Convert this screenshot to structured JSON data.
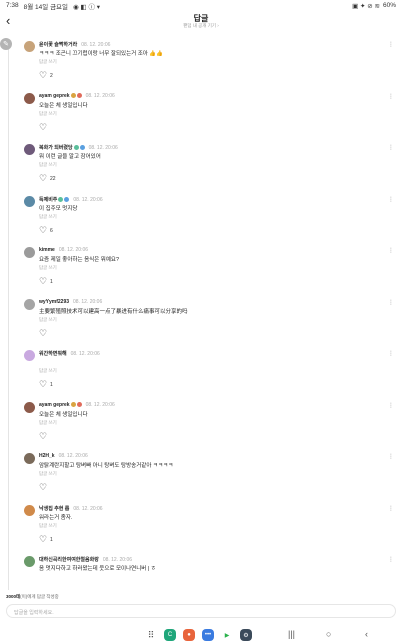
{
  "status": {
    "time": "7:38",
    "date": "8월 14일 금요일",
    "battery": "60%"
  },
  "header": {
    "back_icon": "back-arrow",
    "title": "답글",
    "subtitle": "팬덤 내 공개 기기 ›"
  },
  "comments": [
    {
      "author": "윤이꽃 슬쩍하거라",
      "time": "08. 12. 20:06",
      "text": "ㅋㅋㅋ 조곤니 끄기럽이랑 너무 잘되있는거 조아 👍👍",
      "reply": "답글 쓰기",
      "likes": "2",
      "avatar_color": "#c7a37a",
      "badges": []
    },
    {
      "author": "ayam geprek",
      "time": "08. 12. 20:06",
      "text": "오늘은 체 생일입니다",
      "reply": "답글 쓰기",
      "likes": "",
      "avatar_color": "#8c5a4a",
      "badges": [
        "#d9a441",
        "#e06b5b"
      ]
    },
    {
      "author": "복화가 되버렸당",
      "time": "08. 12. 20:06",
      "text": "뭐 이런 글을 알고 잠어있어",
      "reply": "답글 쓰기",
      "likes": "22",
      "avatar_color": "#6e5a7a",
      "badges": [
        "#5bbf9b",
        "#5aa0e0"
      ]
    },
    {
      "author": "득제비주",
      "time": "08. 12. 20:06",
      "text": "이 집주모 멋지당",
      "reply": "답글 쓰기",
      "likes": "6",
      "avatar_color": "#5b8aa6",
      "badges": [
        "#5bbf9b",
        "#5aa0e0"
      ]
    },
    {
      "author": "kimme",
      "time": "08. 12. 20:06",
      "text": "요즘 제일 좋아하는 음식은 뭐예요?",
      "reply": "답글 쓰기",
      "likes": "1",
      "avatar_color": "#9b9b9b",
      "badges": []
    },
    {
      "author": "wyYymf2293",
      "time": "08. 12. 20:06",
      "text": "主要繁殖照技术可以建高一点了暴进有什么痛事可以分享的吗",
      "reply": "답글 쓰기",
      "likes": "",
      "avatar_color": "#a5a5a5",
      "badges": []
    },
    {
      "author": "워간하면뭐해",
      "time": "08. 12. 20:06",
      "text": "",
      "reply": "답글 쓰기",
      "likes": "1",
      "avatar_color": "#c9a9e0",
      "badges": []
    },
    {
      "author": "ayam geprek",
      "time": "08. 12. 20:06",
      "text": "오늘은 체 생일입니다",
      "reply": "답글 쓰기",
      "likes": "",
      "avatar_color": "#8c5a4a",
      "badges": [
        "#d9a441",
        "#e06b5b"
      ]
    },
    {
      "author": "H2H_k",
      "time": "08. 12. 20:06",
      "text": "암탉계란지할고 탕벼빠 아니 탕벼도 탕방송거같아 ㅋㅋㅋㅋ",
      "reply": "답글 쓰기",
      "likes": "",
      "avatar_color": "#7a6a5a",
      "badges": []
    },
    {
      "author": "낙생집 추현 룹",
      "time": "08. 12. 20:06",
      "text": "워라는거 좀자.",
      "reply": "답글 쓰기",
      "likes": "1",
      "avatar_color": "#d08a4a",
      "badges": []
    },
    {
      "author": "대하신곡리한여여한철음화랑",
      "time": "08. 12. 20:06",
      "text": "음 멋지다하고 하러왔는데 웃으로 모이나연니버 | ㅎ",
      "reply": "",
      "likes": "",
      "avatar_color": "#6a9a6a",
      "badges": []
    }
  ],
  "composer": {
    "hint_bold": "3000테",
    "hint_rest": "(이)에게 답글 작성중",
    "placeholder": "답글을 입력하세요."
  },
  "nav": {
    "apps": [
      {
        "name": "phone-app",
        "color": "#1fa67a",
        "glyph": "C"
      },
      {
        "name": "contacts-app",
        "color": "#e8643c",
        "glyph": "●"
      },
      {
        "name": "messages-app",
        "color": "#3a7be0",
        "glyph": "•••"
      },
      {
        "name": "play-store-app",
        "color": "#ffffff",
        "glyph": "▶"
      },
      {
        "name": "settings-app",
        "color": "#3b4a5a",
        "glyph": "⚙"
      }
    ]
  }
}
